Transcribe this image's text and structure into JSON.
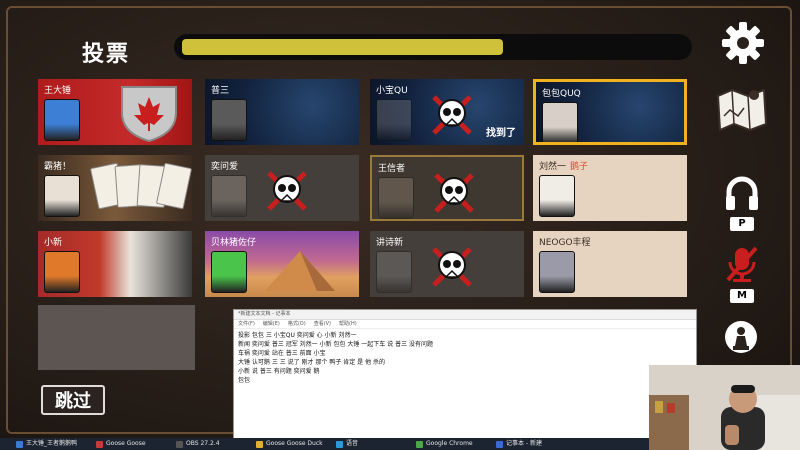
{
  "screen": {
    "title": "投票",
    "timer_fraction": 0.64,
    "skip_label": "跳过"
  },
  "players": [
    {
      "name": "王大锤",
      "suffix": "",
      "state": "alive",
      "theme": "canada",
      "avatar_color": "#3c7fd4",
      "highlight": false,
      "found": ""
    },
    {
      "name": "普三",
      "suffix": "",
      "state": "alive",
      "theme": "space",
      "avatar_color": "#5a5a5a",
      "highlight": false,
      "found": ""
    },
    {
      "name": "小宝QU",
      "suffix": "",
      "state": "dead",
      "theme": "space",
      "avatar_color": "#8a8a8a",
      "highlight": false,
      "found": "找到了"
    },
    {
      "name": "包包QUQ",
      "suffix": "",
      "state": "alive",
      "theme": "space",
      "avatar_color": "#d8d0c8",
      "highlight": true,
      "found": ""
    },
    {
      "name": "霸猪！",
      "suffix": "",
      "state": "alive",
      "theme": "cards",
      "avatar_color": "#e8e0d4",
      "highlight": false,
      "found": ""
    },
    {
      "name": "奕问爱",
      "suffix": "",
      "state": "dead",
      "theme": "plain-dark",
      "avatar_color": "#b0a8a0",
      "highlight": false,
      "found": ""
    },
    {
      "name": "王信者",
      "suffix": "",
      "state": "dead",
      "theme": "plain-gold",
      "avatar_color": "#a09080",
      "highlight": false,
      "found": ""
    },
    {
      "name": "刘然一",
      "suffix": "鹅子",
      "state": "alive",
      "theme": "plain-light",
      "avatar_color": "#f0ece6",
      "highlight": false,
      "found": ""
    },
    {
      "name": "小新",
      "suffix": "",
      "state": "alive",
      "theme": "goose-art",
      "avatar_color": "#e07a2a",
      "highlight": false,
      "found": ""
    },
    {
      "name": "贝林猪佐仔",
      "suffix": "",
      "state": "alive",
      "theme": "desert",
      "avatar_color": "#4ac44a",
      "highlight": false,
      "found": ""
    },
    {
      "name": "讲诗新",
      "suffix": "",
      "state": "dead",
      "theme": "plain-dark",
      "avatar_color": "#888888",
      "highlight": false,
      "found": ""
    },
    {
      "name": "NEOGO丰程",
      "suffix": "",
      "state": "alive",
      "theme": "plain-light",
      "avatar_color": "#9a9aa8",
      "highlight": false,
      "found": ""
    }
  ],
  "icons": {
    "settings": "gear-icon",
    "map": "map-icon",
    "headphones": "headphones-icon",
    "microphone_muted": "mic-muted-icon",
    "chat_toggle": "pawn-icon"
  },
  "keys": {
    "push_to_talk": "P",
    "mute": "M"
  },
  "notepad": {
    "title": "*新建文本文档 - 记事本",
    "menu": [
      "文件(F)",
      "编辑(E)",
      "格式(O)",
      "查看(V)",
      "帮助(H)"
    ],
    "lines": [
      "投影 包包 三 小宝QU 奕问爱 心 小新 刘然一",
      "新闻 奕问爱 普三 冠军  刘然一 小新 包包 大锤 一起下车 说 普三 没有问题",
      "车祸 奕问爱 站在 普三 前面 小宝",
      "大锤 认可鹅 三 三 说了 刚才 那个 鸭子 肯定 是 他 杀的",
      "小新 说 普三 有问题 奕问爱 鹅",
      "包包"
    ]
  },
  "taskbar": [
    {
      "label": "王大锤_王者鹅鹅鸭",
      "color": "#3a7bd5"
    },
    {
      "label": "Goose Goose",
      "color": "#c83a3a"
    },
    {
      "label": "OBS 27.2.4",
      "color": "#555555"
    },
    {
      "label": "Goose Goose Duck",
      "color": "#e0b030"
    },
    {
      "label": "语音",
      "color": "#2a9ad8"
    },
    {
      "label": "Google Chrome",
      "color": "#4aa84a"
    },
    {
      "label": "记事本 - 新建",
      "color": "#3a6ad8"
    }
  ]
}
